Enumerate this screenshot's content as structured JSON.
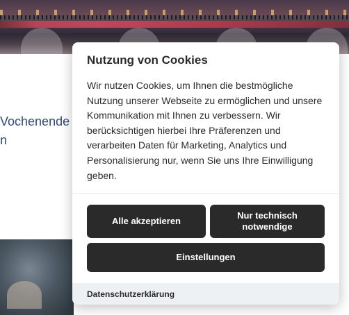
{
  "background": {
    "text_lines": [
      "Vochenende",
      "n"
    ],
    "link_color": "#2f4a78"
  },
  "cookie_dialog": {
    "title": "Nutzung von Cookies",
    "body": "Wir nutzen Cookies, um Ihnen die bestmögliche Nutzung unserer Webseite zu ermöglichen und unsere Kommunikation mit Ihnen zu verbessern. Wir berücksichtigen hierbei Ihre Präferenzen und verarbeiten Daten für Marketing, Analytics und Personalisierung nur, wenn Sie uns Ihre Einwilligung geben.",
    "buttons": {
      "accept_all": "Alle akzeptieren",
      "only_necessary": "Nur technisch notwendige",
      "settings": "Einstellungen"
    },
    "footer": {
      "privacy_link": "Datenschutzerklärung"
    },
    "button_color": "#2a2a2a",
    "footer_color": "#eef1f3"
  }
}
